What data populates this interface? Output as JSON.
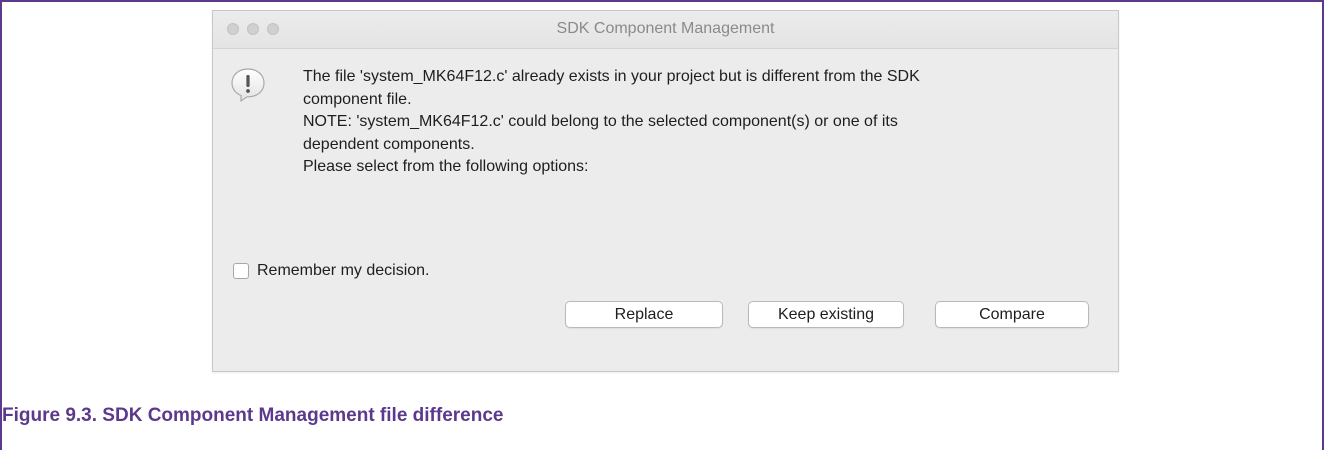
{
  "dialog": {
    "title": "SDK Component Management",
    "message_lines": [
      "The file 'system_MK64F12.c' already exists in your project but is different from the SDK",
      "component file.",
      "NOTE: 'system_MK64F12.c' could belong to the selected component(s) or one of its",
      "dependent components.",
      "Please select from the following options:"
    ],
    "remember_label": "Remember my decision.",
    "remember_checked": false,
    "buttons": {
      "replace": "Replace",
      "keep_existing": "Keep existing",
      "compare": "Compare"
    }
  },
  "caption": "Figure 9.3. SDK Component Management file difference",
  "colors": {
    "caption": "#5b3a8e",
    "frame": "#5b3a8e",
    "dialog_bg": "#ececec"
  }
}
